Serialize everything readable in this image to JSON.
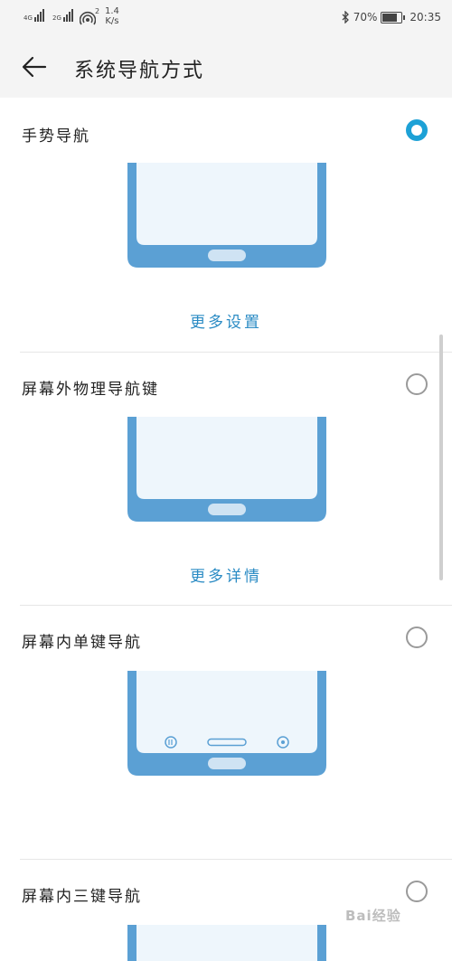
{
  "status_bar": {
    "sim1_label": "4G",
    "sim2_label": "2G",
    "hotspot_count": "2",
    "speed_value": "1.4",
    "speed_unit": "K/s",
    "bluetooth_icon": "bluetooth-icon",
    "battery_percent": "70%",
    "battery_level": 0.7,
    "time": "20:35"
  },
  "app_bar": {
    "title": "系统导航方式",
    "back_icon": "arrow-left-icon"
  },
  "options": [
    {
      "label": "手势导航",
      "selected": true,
      "link": "更多设置"
    },
    {
      "label": "屏幕外物理导航键",
      "selected": false,
      "link": "更多详情"
    },
    {
      "label": "屏幕内单键导航",
      "selected": false
    },
    {
      "label": "屏幕内三键导航",
      "selected": false
    }
  ],
  "watermark": "Bai经验",
  "colors": {
    "accent": "#1da1d6",
    "phone_frame": "#5ba0d4",
    "screen": "#eef6fc",
    "link": "#2a8bc4"
  }
}
